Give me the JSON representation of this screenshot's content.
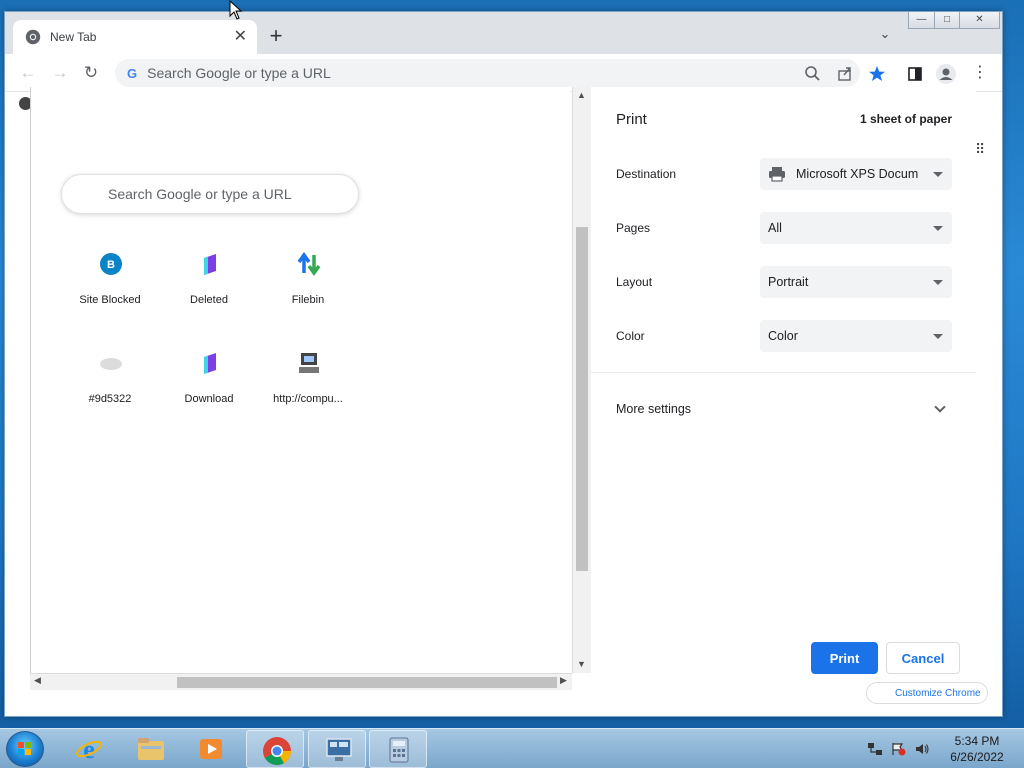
{
  "browser": {
    "tab_title": "New Tab",
    "omnibox_placeholder": "Search Google or type a URL",
    "window_controls": {
      "minimize": "—",
      "maximize": "□",
      "close": "✕"
    }
  },
  "new_tab_page": {
    "search_placeholder": "Search Google or type a URL",
    "shortcuts": [
      {
        "label": "Site Blocked",
        "icon": "circle-b-icon",
        "icon_color": "#0a84c6"
      },
      {
        "label": "Deleted",
        "icon": "purple-book-icon",
        "icon_color": "#7b3fe4"
      },
      {
        "label": "Filebin",
        "icon": "transfer-arrows-icon",
        "icon_color": "#1a73e8"
      },
      {
        "label": "#9d5322",
        "icon": "gray-cloud-icon",
        "icon_color": "#cccccc"
      },
      {
        "label": "Download",
        "icon": "purple-book-icon",
        "icon_color": "#7b3fe4"
      },
      {
        "label": "http://compu...",
        "icon": "computer-icon",
        "icon_color": "#555555"
      }
    ],
    "customize_label": "Customize Chrome"
  },
  "print_dialog": {
    "title": "Print",
    "sheet_count": "1 sheet of paper",
    "fields": {
      "destination": {
        "label": "Destination",
        "value": "Microsoft XPS Docum"
      },
      "pages": {
        "label": "Pages",
        "value": "All"
      },
      "layout": {
        "label": "Layout",
        "value": "Portrait"
      },
      "color": {
        "label": "Color",
        "value": "Color"
      }
    },
    "more_settings": "More settings",
    "print_button": "Print",
    "cancel_button": "Cancel"
  },
  "taskbar": {
    "apps": [
      "internet-explorer-icon",
      "file-explorer-icon",
      "media-player-icon",
      "chrome-icon",
      "remote-desktop-icon",
      "calculator-icon"
    ],
    "clock_time": "5:34 PM",
    "clock_date": "6/26/2022"
  },
  "colors": {
    "accent": "#1a73e8",
    "desktop": "#1f77c4"
  }
}
